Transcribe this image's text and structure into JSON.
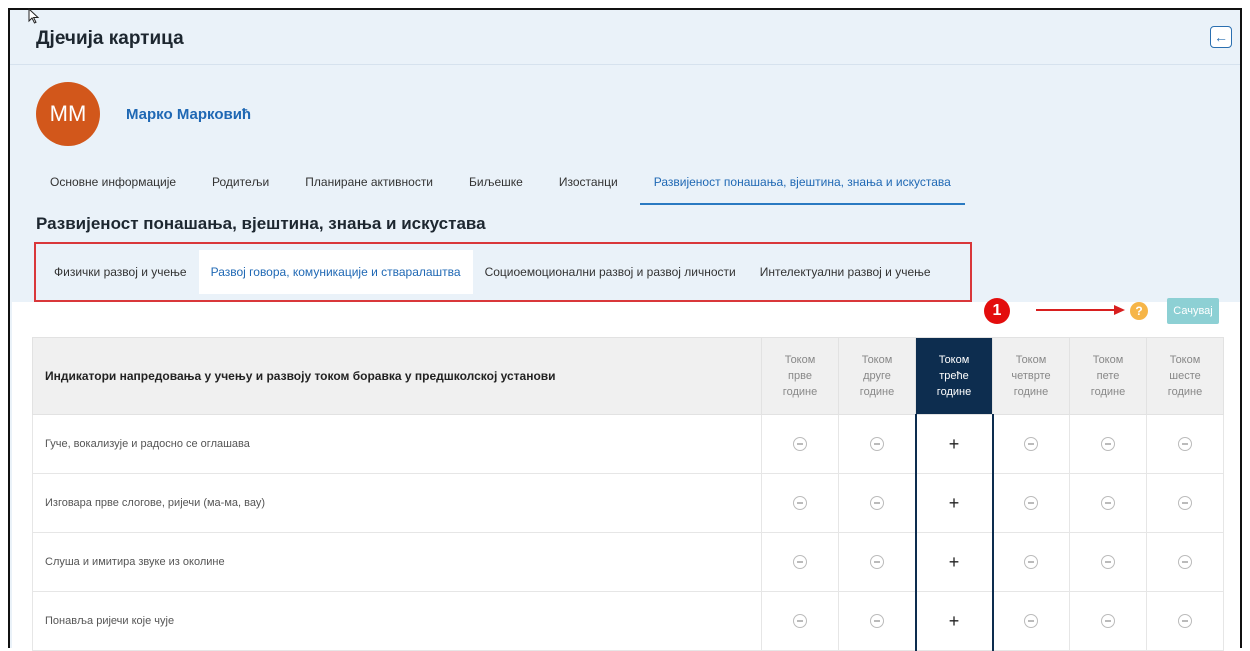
{
  "app": {
    "title": "Дјечија картица",
    "back_icon": "←"
  },
  "child": {
    "initials": "ММ",
    "name": "Марко Марковић",
    "avatar_color": "#d2571b"
  },
  "nav": {
    "tabs": [
      {
        "label": "Основне информације",
        "active": false
      },
      {
        "label": "Родитељи",
        "active": false
      },
      {
        "label": "Планиране активности",
        "active": false
      },
      {
        "label": "Биљешке",
        "active": false
      },
      {
        "label": "Изостанци",
        "active": false
      },
      {
        "label": "Развијеност понашања, вјештина, знања и искустава",
        "active": true
      }
    ]
  },
  "section": {
    "title": "Развијеност понашања, вјештина, знања и искустава",
    "subtabs": [
      {
        "label": "Физички развој и учење",
        "active": false
      },
      {
        "label": "Развој говора, комуникације и стваралаштва",
        "active": true
      },
      {
        "label": "Социоемоционални развој и развој личности",
        "active": false
      },
      {
        "label": "Интелектуални развој и учење",
        "active": false
      }
    ]
  },
  "annotation": {
    "marker": "1",
    "marker_color": "#e30d0d"
  },
  "toolbar": {
    "help_icon": "?",
    "save_label": "Сачувај"
  },
  "table": {
    "indicator_header": "Индикатори напредовања у учењу и развоју током боравка у предшколској установи",
    "years": [
      [
        "Током",
        "прве",
        "године"
      ],
      [
        "Током",
        "друге",
        "године"
      ],
      [
        "Током",
        "треће",
        "године"
      ],
      [
        "Током",
        "четврте",
        "године"
      ],
      [
        "Током",
        "пете",
        "године"
      ],
      [
        "Током",
        "шесте",
        "године"
      ]
    ],
    "selected_year_index": 2,
    "plus_symbol": "+",
    "rows": [
      {
        "indicator": "Гуче, вокализује и радосно се оглашава",
        "marks": [
          "minus",
          "minus",
          "plus",
          "minus",
          "minus",
          "minus"
        ]
      },
      {
        "indicator": "Изговара прве слогове, ријечи (ма-ма, вау)",
        "marks": [
          "minus",
          "minus",
          "plus",
          "minus",
          "minus",
          "minus"
        ]
      },
      {
        "indicator": "Слуша и имитира звуке из околине",
        "marks": [
          "minus",
          "minus",
          "plus",
          "minus",
          "minus",
          "minus"
        ]
      },
      {
        "indicator": "Понавља ријечи које чује",
        "marks": [
          "minus",
          "minus",
          "plus",
          "minus",
          "minus",
          "minus"
        ]
      }
    ]
  }
}
